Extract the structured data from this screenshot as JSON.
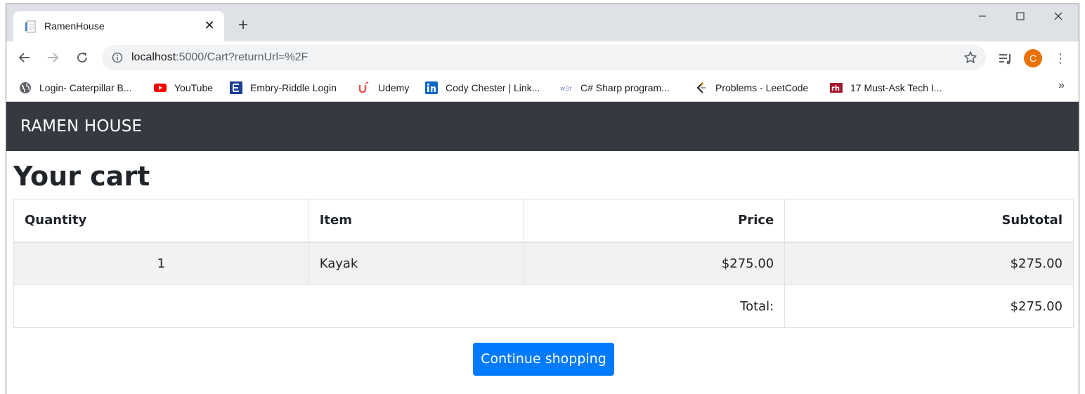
{
  "browser": {
    "tab_title": "RamenHouse",
    "tab_close_glyph": "✕",
    "new_tab_glyph": "+",
    "url_host": "localhost",
    "url_rest": ":5000/Cart?returnUrl=%2F",
    "avatar_letter": "C",
    "avatar_color": "#e8710a",
    "window_controls": [
      "minimize-icon",
      "maximize-icon",
      "close-icon"
    ]
  },
  "bookmarks": [
    {
      "label": "Login- Caterpillar B...",
      "icon": "globe-icon"
    },
    {
      "label": "YouTube",
      "icon": "youtube-icon"
    },
    {
      "label": "Embry-Riddle Login",
      "icon": "embry-riddle-icon"
    },
    {
      "label": "Udemy",
      "icon": "udemy-icon"
    },
    {
      "label": "Cody Chester | Link...",
      "icon": "linkedin-icon"
    },
    {
      "label": "C# Sharp program...",
      "icon": "w3r-icon"
    },
    {
      "label": "Problems - LeetCode",
      "icon": "leetcode-icon"
    },
    {
      "label": "17 Must-Ask Tech I...",
      "icon": "rh-icon"
    }
  ],
  "bookmarks_more": "»",
  "site": {
    "brand": "RAMEN HOUSE",
    "navbar_color": "#343a40",
    "heading": "Your cart",
    "table": {
      "headers": [
        "Quantity",
        "Item",
        "Price",
        "Subtotal"
      ],
      "rows": [
        {
          "quantity": "1",
          "item": "Kayak",
          "price": "$275.00",
          "subtotal": "$275.00"
        }
      ],
      "total_label": "Total:",
      "total_value": "$275.00"
    },
    "continue_button": "Continue shopping",
    "button_color": "#007bff"
  }
}
